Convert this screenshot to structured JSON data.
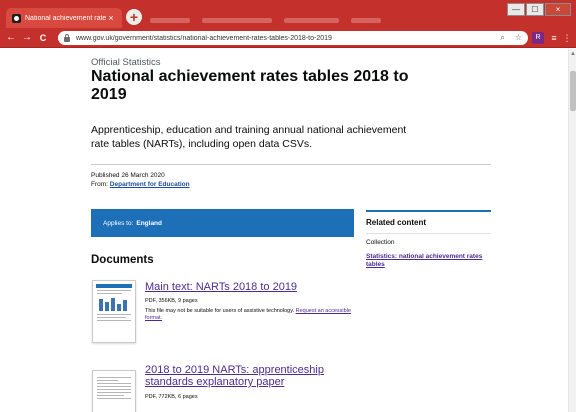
{
  "browser": {
    "tab_title": "National achievement rates table",
    "tab_close": "×",
    "new_tab": "+",
    "url": "www.gov.uk/government/statistics/national-achievement-rates-tables-2018-to-2019",
    "back": "←",
    "forward": "→",
    "reload": "C",
    "search_icon": "⌕",
    "star_icon": "☆",
    "minimize": "—",
    "maximize": "☐",
    "close": "×",
    "ext1_label": "R",
    "ext2_label": "≡",
    "menu": "⋮"
  },
  "page": {
    "kicker": "Official Statistics",
    "title": "National achievement rates tables 2018 to 2019",
    "summary": "Apprenticeship, education and training annual national achievement rate tables (NARTs), including open data CSVs.",
    "published": "Published 26 March 2020",
    "from_label": "From:",
    "from_link": "Department for Education",
    "applies_label": "Applies to:",
    "applies_value": "England",
    "documents_heading": "Documents"
  },
  "related": {
    "title": "Related content",
    "sub": "Collection",
    "link": "Statistics: national achievement rates tables"
  },
  "documents": [
    {
      "title": "Main text: NARTs 2018 to 2019",
      "meta": "PDF, 356KB, 9 pages",
      "note": "This file may not be suitable for users of assistive technology.",
      "note_link": "Request an accessible format."
    },
    {
      "title": "2018 to 2019 NARTs: apprenticeship standards explanatory paper",
      "meta": "PDF, 772KB, 6 pages"
    }
  ],
  "colors": {
    "browser_chrome": "#c4302b",
    "govuk_blue": "#1d70b8",
    "link_visited": "#4c2c92"
  }
}
